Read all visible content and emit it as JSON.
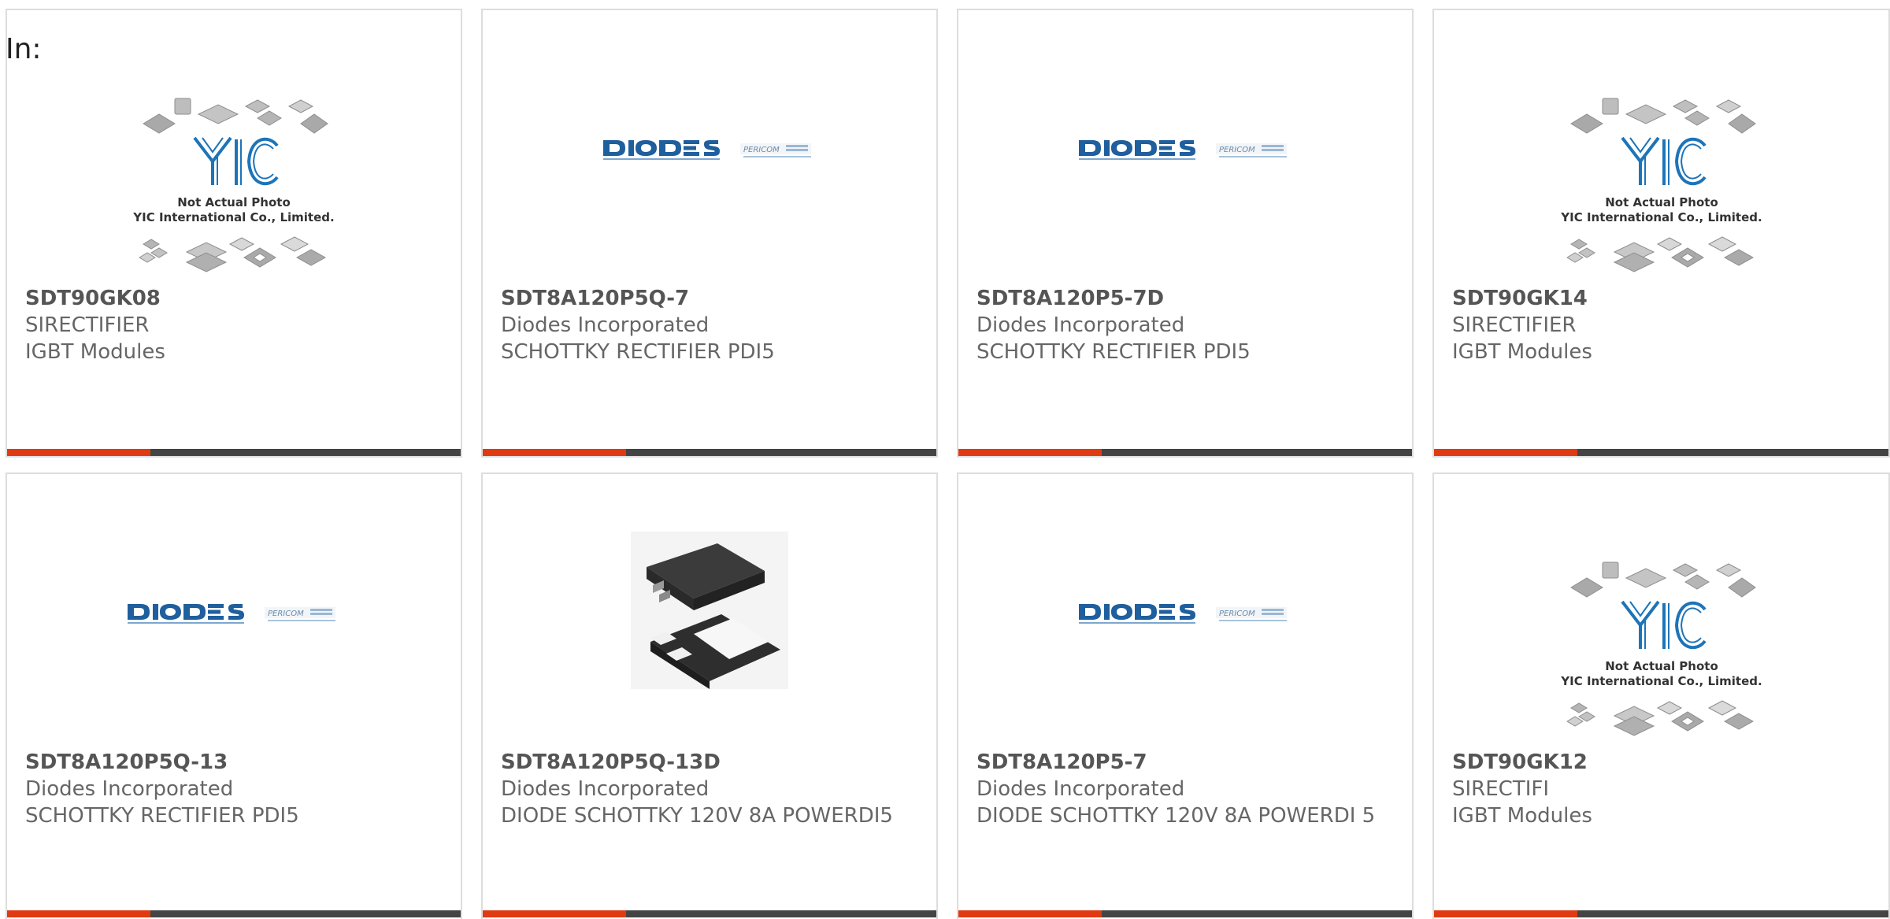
{
  "page": {
    "in_label": "In:"
  },
  "placeholder_text": {
    "line1": "Not Actual Photo",
    "line2": "YIC International Co., Limited."
  },
  "brand": {
    "accent_color": "#e03a12",
    "bar_color": "#444444"
  },
  "products": [
    {
      "part_number": "SDT90GK08",
      "manufacturer": "SIRECTIFIER",
      "description": "IGBT Modules",
      "image": "yic-placeholder"
    },
    {
      "part_number": "SDT8A120P5Q-7",
      "manufacturer": "Diodes Incorporated",
      "description": "SCHOTTKY RECTIFIER PDI5",
      "image": "diodes-logo"
    },
    {
      "part_number": "SDT8A120P5-7D",
      "manufacturer": "Diodes Incorporated",
      "description": "SCHOTTKY RECTIFIER PDI5",
      "image": "diodes-logo"
    },
    {
      "part_number": "SDT90GK14",
      "manufacturer": "SIRECTIFIER",
      "description": "IGBT Modules",
      "image": "yic-placeholder"
    },
    {
      "part_number": "SDT8A120P5Q-13",
      "manufacturer": "Diodes Incorporated",
      "description": "SCHOTTKY RECTIFIER PDI5",
      "image": "diodes-logo"
    },
    {
      "part_number": "SDT8A120P5Q-13D",
      "manufacturer": "Diodes Incorporated",
      "description": "DIODE SCHOTTKY 120V 8A POWERDI5",
      "image": "package-photo"
    },
    {
      "part_number": "SDT8A120P5-7",
      "manufacturer": "Diodes Incorporated",
      "description": "DIODE SCHOTTKY 120V 8A POWERDI 5",
      "image": "diodes-logo"
    },
    {
      "part_number": "SDT90GK12",
      "manufacturer": "SIRECTIFI",
      "description": "IGBT Modules",
      "image": "yic-placeholder"
    }
  ]
}
